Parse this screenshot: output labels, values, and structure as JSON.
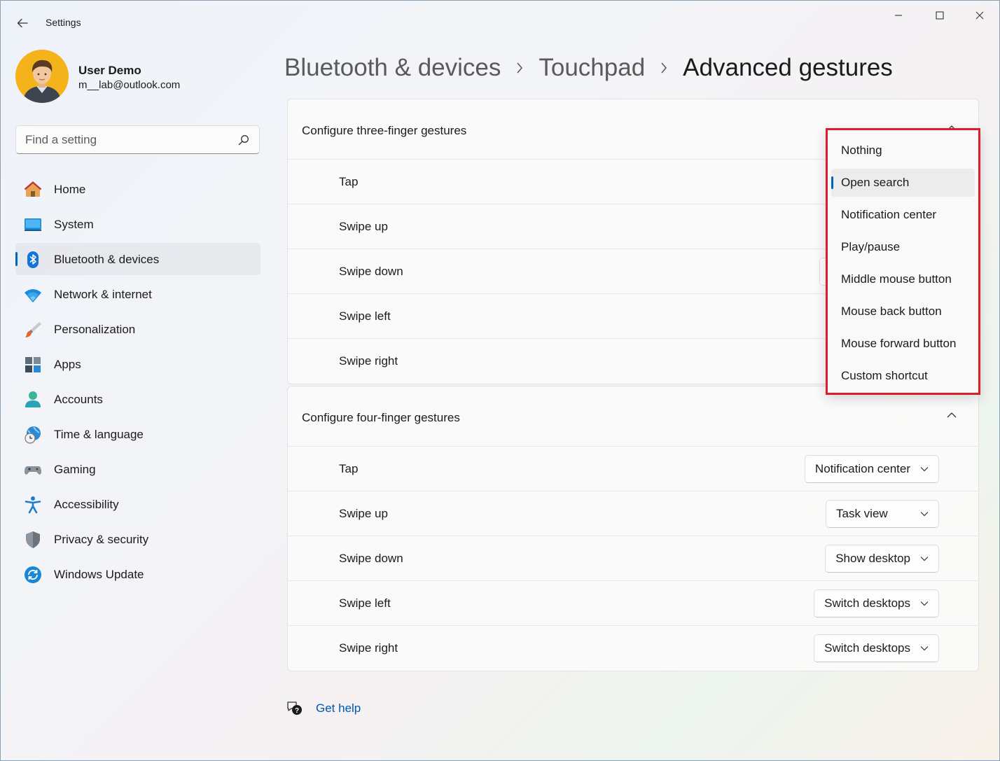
{
  "app": {
    "title": "Settings"
  },
  "user": {
    "name": "User Demo",
    "email": "m__lab@outlook.com"
  },
  "search": {
    "placeholder": "Find a setting"
  },
  "nav": {
    "items": [
      {
        "label": "Home",
        "icon": "home-icon"
      },
      {
        "label": "System",
        "icon": "system-icon"
      },
      {
        "label": "Bluetooth & devices",
        "icon": "bluetooth-icon",
        "active": true
      },
      {
        "label": "Network & internet",
        "icon": "wifi-icon"
      },
      {
        "label": "Personalization",
        "icon": "brush-icon"
      },
      {
        "label": "Apps",
        "icon": "apps-icon"
      },
      {
        "label": "Accounts",
        "icon": "person-icon"
      },
      {
        "label": "Time & language",
        "icon": "globe-clock-icon"
      },
      {
        "label": "Gaming",
        "icon": "gamepad-icon"
      },
      {
        "label": "Accessibility",
        "icon": "accessibility-icon"
      },
      {
        "label": "Privacy & security",
        "icon": "shield-icon"
      },
      {
        "label": "Windows Update",
        "icon": "update-icon"
      }
    ]
  },
  "breadcrumb": {
    "level1": "Bluetooth & devices",
    "level2": "Touchpad",
    "current": "Advanced gestures"
  },
  "three_finger": {
    "title": "Configure three-finger gestures",
    "rows": [
      {
        "label": "Tap"
      },
      {
        "label": "Swipe up"
      },
      {
        "label": "Swipe down"
      },
      {
        "label": "Swipe left"
      },
      {
        "label": "Swipe right"
      }
    ]
  },
  "dropdown": {
    "options": [
      "Nothing",
      "Open search",
      "Notification center",
      "Play/pause",
      "Middle mouse button",
      "Mouse back button",
      "Mouse forward button",
      "Custom shortcut"
    ],
    "selected": "Open search"
  },
  "four_finger": {
    "title": "Configure four-finger gestures",
    "rows": [
      {
        "label": "Tap",
        "value": "Notification center"
      },
      {
        "label": "Swipe up",
        "value": "Task view"
      },
      {
        "label": "Swipe down",
        "value": "Show desktop"
      },
      {
        "label": "Swipe left",
        "value": "Switch desktops"
      },
      {
        "label": "Swipe right",
        "value": "Switch desktops"
      }
    ]
  },
  "help": {
    "label": "Get help"
  },
  "colors": {
    "accent": "#0067c0",
    "highlight_border": "#d8202c",
    "link": "#0058a8"
  }
}
